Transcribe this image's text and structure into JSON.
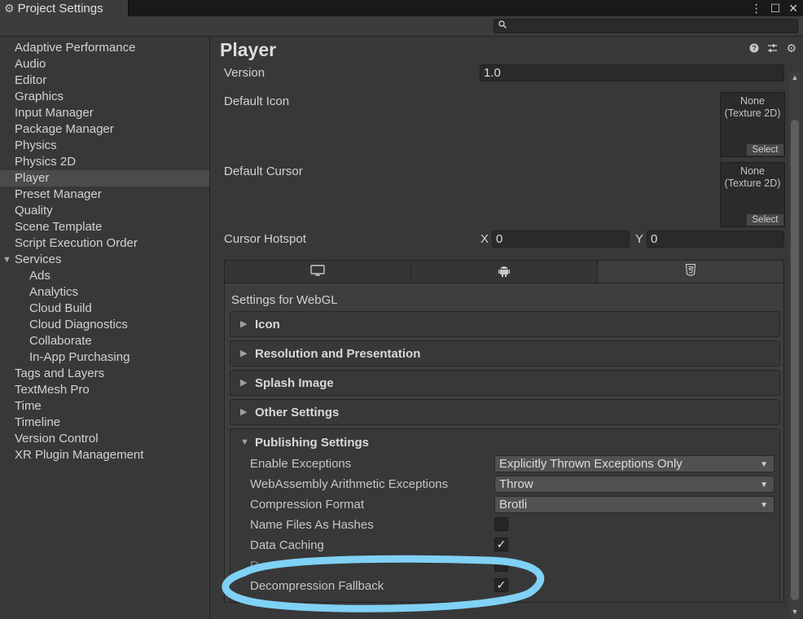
{
  "window": {
    "tab_title": "Project Settings",
    "controls": [
      "⋮",
      "☐",
      "✕"
    ]
  },
  "search": {
    "placeholder": "",
    "value": ""
  },
  "sidebar": {
    "items": [
      {
        "label": "Adaptive Performance",
        "level": 0
      },
      {
        "label": "Audio",
        "level": 0
      },
      {
        "label": "Editor",
        "level": 0
      },
      {
        "label": "Graphics",
        "level": 0
      },
      {
        "label": "Input Manager",
        "level": 0
      },
      {
        "label": "Package Manager",
        "level": 0
      },
      {
        "label": "Physics",
        "level": 0
      },
      {
        "label": "Physics 2D",
        "level": 0
      },
      {
        "label": "Player",
        "level": 0,
        "selected": true
      },
      {
        "label": "Preset Manager",
        "level": 0
      },
      {
        "label": "Quality",
        "level": 0
      },
      {
        "label": "Scene Template",
        "level": 0
      },
      {
        "label": "Script Execution Order",
        "level": 0
      },
      {
        "label": "Services",
        "level": 0,
        "expanded": true
      },
      {
        "label": "Ads",
        "level": 1
      },
      {
        "label": "Analytics",
        "level": 1
      },
      {
        "label": "Cloud Build",
        "level": 1
      },
      {
        "label": "Cloud Diagnostics",
        "level": 1
      },
      {
        "label": "Collaborate",
        "level": 1
      },
      {
        "label": "In-App Purchasing",
        "level": 1
      },
      {
        "label": "Tags and Layers",
        "level": 0
      },
      {
        "label": "TextMesh Pro",
        "level": 0
      },
      {
        "label": "Time",
        "level": 0
      },
      {
        "label": "Timeline",
        "level": 0
      },
      {
        "label": "Version Control",
        "level": 0
      },
      {
        "label": "XR Plugin Management",
        "level": 0
      }
    ]
  },
  "main": {
    "title": "Player",
    "version_label": "Version",
    "version_value": "1.0",
    "default_icon_label": "Default Icon",
    "default_cursor_label": "Default Cursor",
    "texture_none": "None",
    "texture_type": "(Texture 2D)",
    "select_label": "Select",
    "cursor_hotspot_label": "Cursor Hotspot",
    "hotspot_x_label": "X",
    "hotspot_x_value": "0",
    "hotspot_y_label": "Y",
    "hotspot_y_value": "0"
  },
  "platform": {
    "tabs": [
      {
        "icon": "monitor-icon"
      },
      {
        "icon": "android-icon"
      },
      {
        "icon": "html5-icon",
        "active": true
      }
    ],
    "settings_for": "Settings for WebGL",
    "sections": [
      "Icon",
      "Resolution and Presentation",
      "Splash Image",
      "Other Settings"
    ],
    "publishing": {
      "title": "Publishing Settings",
      "enable_exceptions_label": "Enable Exceptions",
      "enable_exceptions_value": "Explicitly Thrown Exceptions Only",
      "wasm_arith_label": "WebAssembly Arithmetic Exceptions",
      "wasm_arith_value": "Throw",
      "compression_label": "Compression Format",
      "compression_value": "Brotli",
      "name_hashes_label": "Name Files As Hashes",
      "name_hashes_checked": false,
      "data_caching_label": "Data Caching",
      "data_caching_checked": true,
      "partial_label": "D",
      "decomp_label": "Decompression Fallback",
      "decomp_checked": true
    }
  },
  "colors": {
    "annotation": "#7fd1f5",
    "background": "#383838"
  }
}
